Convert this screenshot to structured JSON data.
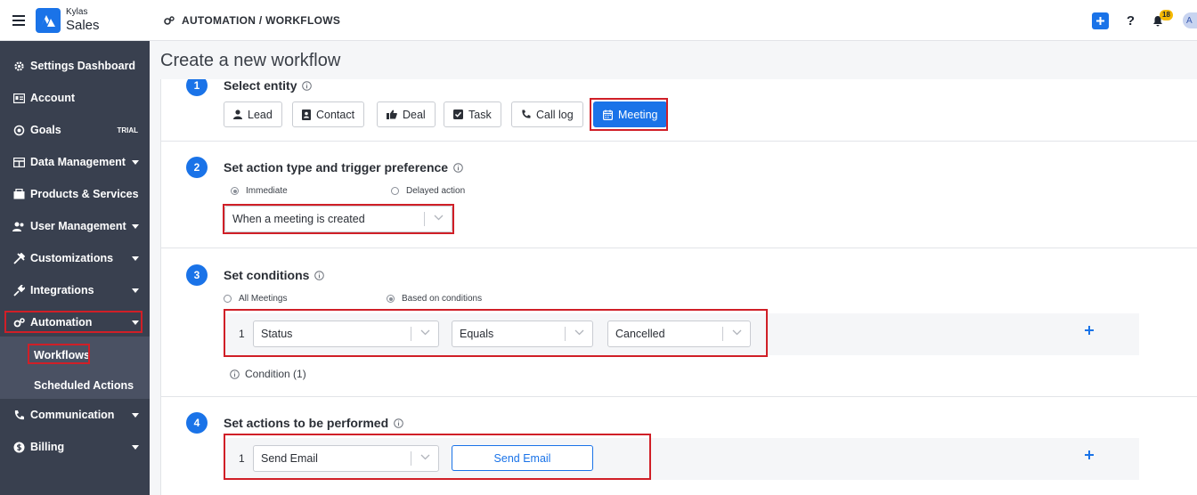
{
  "app": {
    "brand_top": "Kylas",
    "brand_bottom": "Sales"
  },
  "header": {
    "breadcrumb": "AUTOMATION / WORKFLOWS",
    "notification_count": "18",
    "avatar_initial": "A",
    "help_label": "?"
  },
  "sidebar": {
    "items": [
      {
        "label": "Settings Dashboard",
        "icon": "gear-icon"
      },
      {
        "label": "Account",
        "icon": "id-card-icon"
      },
      {
        "label": "Goals",
        "icon": "target-icon",
        "badge": "TRIAL"
      },
      {
        "label": "Data Management",
        "icon": "table-icon",
        "expandable": true
      },
      {
        "label": "Products & Services",
        "icon": "box-icon"
      },
      {
        "label": "User Management",
        "icon": "users-icon",
        "expandable": true
      },
      {
        "label": "Customizations",
        "icon": "tools-icon",
        "expandable": true
      },
      {
        "label": "Integrations",
        "icon": "plug-icon",
        "expandable": true
      },
      {
        "label": "Automation",
        "icon": "cogs-icon",
        "expandable": true,
        "active": true
      },
      {
        "label": "Communication",
        "icon": "phone-icon",
        "expandable": true
      },
      {
        "label": "Billing",
        "icon": "dollar-icon",
        "expandable": true
      }
    ],
    "automation_sub": [
      "Workflows",
      "Scheduled Actions"
    ]
  },
  "page": {
    "title": "Create a new workflow"
  },
  "step1": {
    "number": "1",
    "title": "Select entity",
    "entities": [
      "Lead",
      "Contact",
      "Deal",
      "Task",
      "Call log",
      "Meeting"
    ],
    "selected": "Meeting"
  },
  "step2": {
    "number": "2",
    "title": "Set action type and trigger preference",
    "option_immediate": "Immediate",
    "option_delayed": "Delayed action",
    "selected_option": "Immediate",
    "trigger_value": "When a meeting is created"
  },
  "step3": {
    "number": "3",
    "title": "Set conditions",
    "option_all": "All Meetings",
    "option_based": "Based on conditions",
    "selected_option": "Based on conditions",
    "row_number": "1",
    "field": "Status",
    "operator": "Equals",
    "value": "Cancelled",
    "condition_count": "Condition (1)"
  },
  "step4": {
    "number": "4",
    "title": "Set actions to be performed",
    "row_number": "1",
    "action_type": "Send Email",
    "action_button": "Send Email"
  },
  "colors": {
    "accent": "#1a73e8",
    "sidebar_bg": "#39404f",
    "highlight": "#d01f27",
    "badge": "#f5b800"
  }
}
